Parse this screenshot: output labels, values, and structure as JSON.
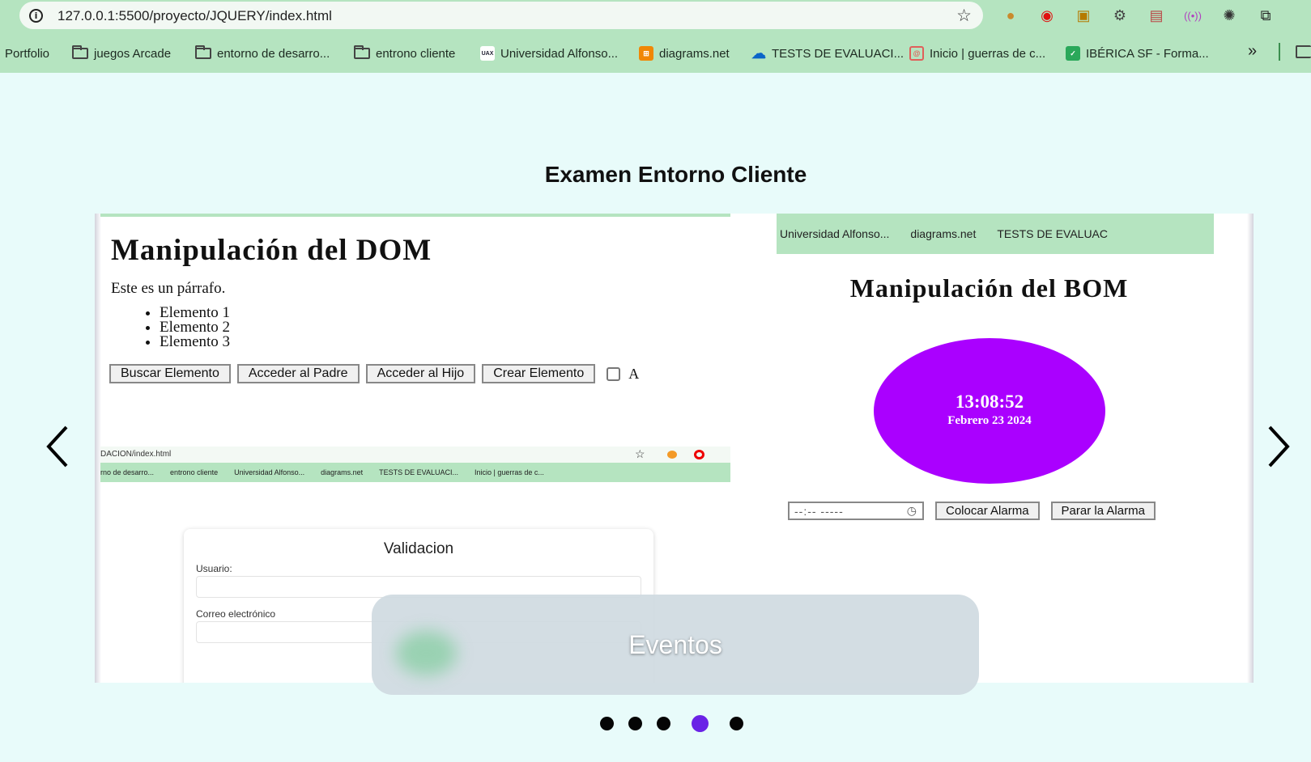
{
  "browser": {
    "url": "127.0.0.1:5500/proyecto/JQUERY/index.html",
    "bookmarks": [
      {
        "label": "Portfolio",
        "icon": "none"
      },
      {
        "label": "juegos Arcade",
        "icon": "folder-icon"
      },
      {
        "label": "entorno de desarro...",
        "icon": "folder-icon"
      },
      {
        "label": "entrono cliente",
        "icon": "folder-icon"
      },
      {
        "label": "Universidad Alfonso...",
        "icon": "uax-favicon",
        "badge": "UAX"
      },
      {
        "label": "diagrams.net",
        "icon": "diagrams-favicon"
      },
      {
        "label": "TESTS DE EVALUACI...",
        "icon": "onedrive-favicon"
      },
      {
        "label": "Inicio | guerras de c...",
        "icon": "swirl-favicon"
      },
      {
        "label": "IBÉRICA SF - Forma...",
        "icon": "check-favicon"
      }
    ],
    "more": "»"
  },
  "page": {
    "title": "Examen Entorno Cliente"
  },
  "slide": {
    "dom": {
      "heading": "Manipulación del DOM",
      "paragraph": "Este es un párrafo.",
      "items": [
        "Elemento 1",
        "Elemento 2",
        "Elemento 3"
      ],
      "buttons": [
        "Buscar Elemento",
        "Acceder al Padre",
        "Acceder al Hijo",
        "Crear Elemento"
      ],
      "checkbox_label": "A"
    },
    "mini_browser": {
      "url": "DACION/index.html",
      "bookmarks": [
        "rno de desarro...",
        "entrono cliente",
        "Universidad Alfonso...",
        "diagrams.net",
        "TESTS DE EVALUACI...",
        "Inicio | guerras de c..."
      ]
    },
    "validation": {
      "title": "Validacion",
      "user_label": "Usuario:",
      "email_label": "Correo electrónico"
    },
    "bom": {
      "bookmarks": [
        "Universidad Alfonso...",
        "diagrams.net",
        "TESTS DE EVALUAC"
      ],
      "heading": "Manipulación del BOM",
      "time": "13:08:52",
      "date": "Febrero 23 2024",
      "time_input": "--:-- -----",
      "buttons": [
        "Colocar Alarma",
        "Parar la Alarma"
      ],
      "clock_color": "#aa00ff"
    }
  },
  "caption": "Eventos",
  "indicators": {
    "count": 5,
    "active_index": 3,
    "active_color": "#6a22e6"
  },
  "colors": {
    "page_bg": "#e8fbfa",
    "chrome": "#b5e4c0"
  }
}
